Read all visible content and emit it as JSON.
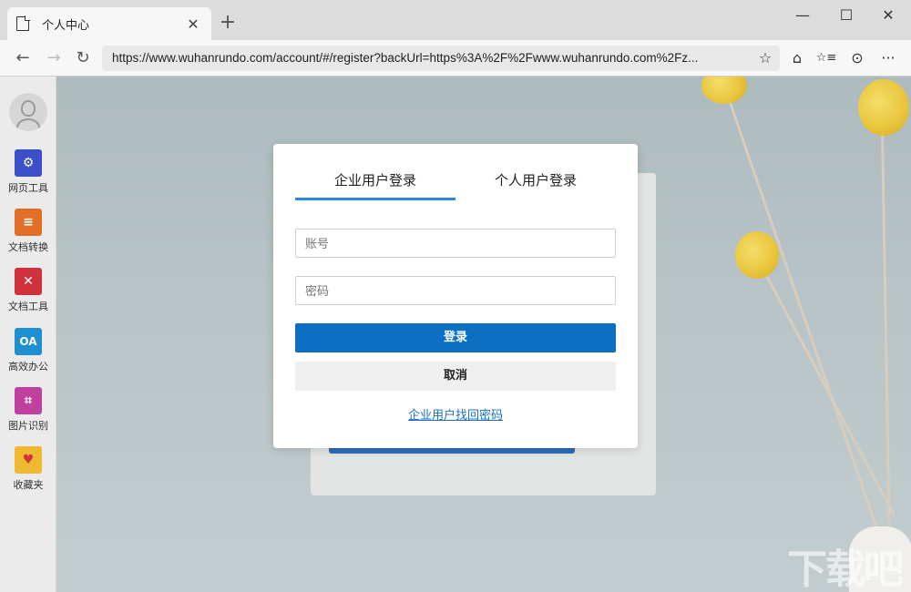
{
  "browser": {
    "tab_title": "个人中心",
    "tab_close": "✕",
    "new_tab": "+",
    "url": "https://www.wuhanrundo.com/account/#/register?backUrl=https%3A%2F%2Fwww.wuhanrundo.com%2Fz...",
    "window_controls": {
      "minimize": "—",
      "maximize": "☐",
      "close": "✕"
    },
    "nav": {
      "back": "←",
      "forward": "→",
      "refresh": "↻"
    },
    "toolbar": {
      "favorite": "☆",
      "home": "⌂",
      "favorites_list": "☆≡",
      "collections": "⊙",
      "more": "···"
    }
  },
  "sidebar": {
    "items": [
      {
        "label": "网页工具",
        "icon": "web-tools-icon",
        "color": "#3a4fc8",
        "glyph": "⚙"
      },
      {
        "label": "文档转换",
        "icon": "doc-convert-icon",
        "color": "#e07028",
        "glyph": "≡"
      },
      {
        "label": "文档工具",
        "icon": "doc-tools-icon",
        "color": "#d0323c",
        "glyph": "✕"
      },
      {
        "label": "高效办公",
        "icon": "office-icon",
        "color": "#1e8fd0",
        "glyph": "OA"
      },
      {
        "label": "图片识别",
        "icon": "image-recognition-icon",
        "color": "#c040a0",
        "glyph": "⌗"
      },
      {
        "label": "收藏夹",
        "icon": "favorites-folder-icon",
        "color": "#f0b830",
        "glyph": "♥"
      }
    ]
  },
  "login_modal": {
    "tabs": [
      "企业用户登录",
      "个人用户登录"
    ],
    "active_tab": 0,
    "account_placeholder": "账号",
    "password_placeholder": "密码",
    "login_label": "登录",
    "cancel_label": "取消",
    "recover_link": "企业用户找回密码"
  },
  "watermark": "下载吧",
  "colors": {
    "primary": "#0c6fc4",
    "tab_underline": "#2a8ae0",
    "link": "#1a6fc0"
  }
}
